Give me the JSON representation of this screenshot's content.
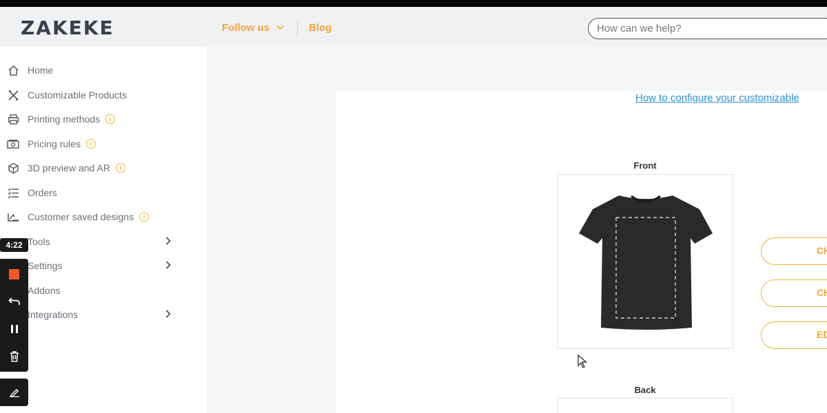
{
  "header": {
    "logo": "ZAKEKE",
    "follow_label": "Follow us",
    "blog_label": "Blog",
    "search_placeholder": "How can we help?"
  },
  "sidebar": {
    "items": [
      {
        "label": "Home",
        "icon": "home-icon"
      },
      {
        "label": "Customizable Products",
        "icon": "tools-icon"
      },
      {
        "label": "Printing methods",
        "icon": "printer-icon",
        "info": true
      },
      {
        "label": "Pricing rules",
        "icon": "money-icon",
        "info": true
      },
      {
        "label": "3D preview and AR",
        "icon": "cube-icon",
        "info": true
      },
      {
        "label": "Orders",
        "icon": "list-icon"
      },
      {
        "label": "Customer saved designs",
        "icon": "designs-icon",
        "info": true
      },
      {
        "label": "Tools",
        "icon": "wrench-icon",
        "expandable": true
      },
      {
        "label": "Settings",
        "icon": "gear-icon",
        "expandable": true
      },
      {
        "label": "Addons",
        "icon": "puzzle-icon"
      },
      {
        "label": "Integrations",
        "icon": "plug-icon",
        "expandable": true
      }
    ],
    "info_glyph": "i",
    "expand_glyph": "›"
  },
  "recorder": {
    "time": "4:22"
  },
  "main": {
    "howto_link": "How to configure your customizable",
    "front_label": "Front",
    "back_label": "Back",
    "buttons": [
      "CH",
      "CH",
      "EDI"
    ]
  },
  "colors": {
    "accent": "#f2a33a",
    "link": "#2a8fd6",
    "record": "#f05a2a"
  }
}
